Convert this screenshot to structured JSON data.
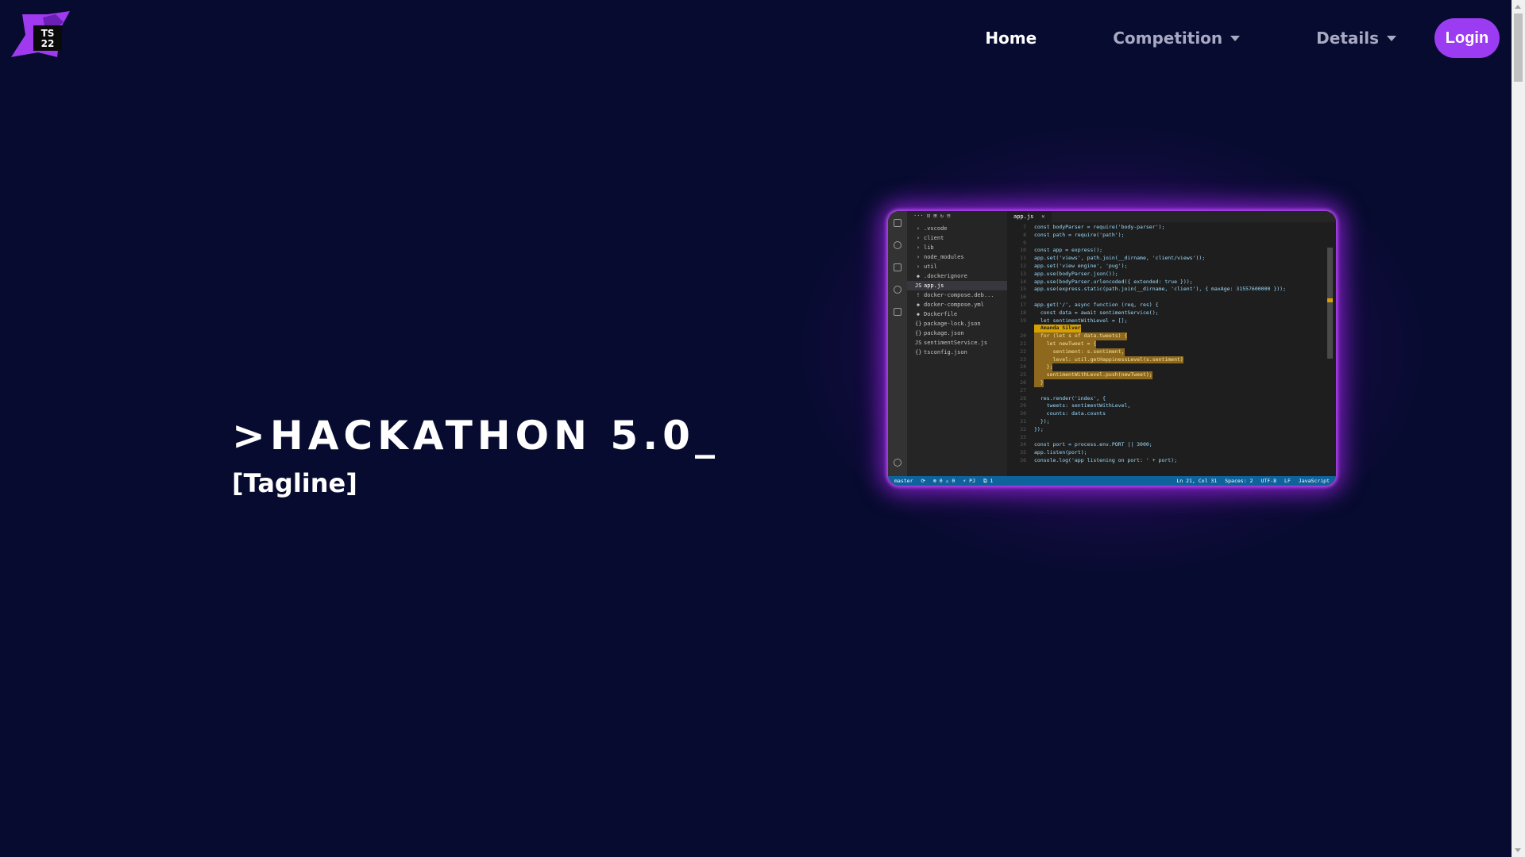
{
  "logo": {
    "text_line1": "TS",
    "text_line2": "22"
  },
  "nav": {
    "home": "Home",
    "competition": "Competition",
    "details": "Details",
    "login": "Login"
  },
  "hero": {
    "title": ">HACKATHON 5.0_",
    "tagline": "[Tagline]"
  },
  "editor": {
    "toolbar": "···  ⊡  ⊞  ↻  ⊟",
    "tab_label": "app.js",
    "tab_close": "×",
    "files": [
      {
        "icon": "›",
        "name": ".vscode",
        "selected": false
      },
      {
        "icon": "›",
        "name": "client",
        "selected": false
      },
      {
        "icon": "›",
        "name": "lib",
        "selected": false
      },
      {
        "icon": "›",
        "name": "node_modules",
        "selected": false
      },
      {
        "icon": "›",
        "name": "util",
        "selected": false
      },
      {
        "icon": "◆",
        "name": ".dockerignore",
        "selected": false
      },
      {
        "icon": "JS",
        "name": "app.js",
        "selected": true
      },
      {
        "icon": "!",
        "name": "docker-compose.deb...",
        "selected": false
      },
      {
        "icon": "◆",
        "name": "docker-compose.yml",
        "selected": false
      },
      {
        "icon": "◆",
        "name": "Dockerfile",
        "selected": false
      },
      {
        "icon": "{}",
        "name": "package-lock.json",
        "selected": false
      },
      {
        "icon": "{}",
        "name": "package.json",
        "selected": false
      },
      {
        "icon": "JS",
        "name": "sentimentService.js",
        "selected": false
      },
      {
        "icon": "{}",
        "name": "tsconfig.json",
        "selected": false
      }
    ],
    "code": [
      {
        "ln": "7",
        "text": "const bodyParser = require('body-parser');",
        "style": ""
      },
      {
        "ln": "8",
        "text": "const path = require('path');",
        "style": ""
      },
      {
        "ln": "9",
        "text": "",
        "style": ""
      },
      {
        "ln": "10",
        "text": "const app = express();",
        "style": ""
      },
      {
        "ln": "11",
        "text": "app.set('views', path.join(__dirname, 'client/views'));",
        "style": ""
      },
      {
        "ln": "12",
        "text": "app.set('view engine', 'pug');",
        "style": ""
      },
      {
        "ln": "13",
        "text": "app.use(bodyParser.json());",
        "style": ""
      },
      {
        "ln": "14",
        "text": "app.use(bodyParser.urlencoded({ extended: true }));",
        "style": ""
      },
      {
        "ln": "15",
        "text": "app.use(express.static(path.join(__dirname, 'client'), { maxAge: 31557600000 }));",
        "style": ""
      },
      {
        "ln": "16",
        "text": "",
        "style": ""
      },
      {
        "ln": "17",
        "text": "app.get('/', async function (req, res) {",
        "style": ""
      },
      {
        "ln": "18",
        "text": "  const data = await sentimentService();",
        "style": ""
      },
      {
        "ln": "19",
        "text": "  let sentimentWithLevel = [];",
        "style": ""
      },
      {
        "ln": "",
        "text": "  Amanda Silver",
        "style": "tag"
      },
      {
        "ln": "20",
        "text": "  for (let s of data.tweets) {",
        "style": "hl"
      },
      {
        "ln": "21",
        "text": "    let newTweet = {",
        "style": "hl"
      },
      {
        "ln": "22",
        "text": "      sentiment: s.sentiment,",
        "style": "hl"
      },
      {
        "ln": "23",
        "text": "      level: util.getHappinessLevel(s.sentiment)",
        "style": "hl"
      },
      {
        "ln": "24",
        "text": "    };",
        "style": "hl"
      },
      {
        "ln": "25",
        "text": "    sentimentWithLevel.push(newTweet);",
        "style": "hl"
      },
      {
        "ln": "26",
        "text": "  }",
        "style": "hl"
      },
      {
        "ln": "27",
        "text": "",
        "style": ""
      },
      {
        "ln": "28",
        "text": "  res.render('index', {",
        "style": ""
      },
      {
        "ln": "29",
        "text": "    tweets: sentimentWithLevel,",
        "style": ""
      },
      {
        "ln": "30",
        "text": "    counts: data.counts",
        "style": ""
      },
      {
        "ln": "31",
        "text": "  });",
        "style": ""
      },
      {
        "ln": "32",
        "text": "});",
        "style": ""
      },
      {
        "ln": "33",
        "text": "",
        "style": ""
      },
      {
        "ln": "34",
        "text": "const port = process.env.PORT || 3000;",
        "style": ""
      },
      {
        "ln": "35",
        "text": "app.listen(port);",
        "style": ""
      },
      {
        "ln": "36",
        "text": "console.log('app listening on port: ' + port);",
        "style": ""
      }
    ],
    "status_left": [
      "master",
      "⟳",
      "⊗ 0 ⚠ 0",
      "⚡ PJ",
      "⧉ 1"
    ],
    "status_right": [
      "Ln 21, Col 31",
      "Spaces: 2",
      "UTF-8",
      "LF",
      "JavaScript"
    ]
  },
  "colors": {
    "background": "#070b2f",
    "accent": "#9b3cf3",
    "glow": "#b028ff"
  }
}
